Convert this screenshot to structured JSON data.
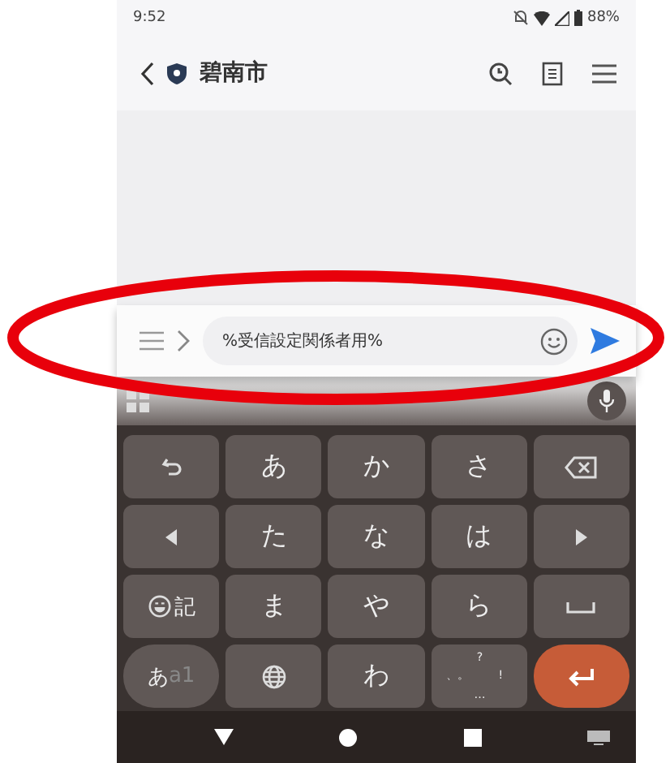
{
  "status_bar": {
    "time": "9:52",
    "battery": "88%"
  },
  "header": {
    "title": "碧南市"
  },
  "input_bar": {
    "value": "%受信設定関係者用%"
  },
  "keyboard": {
    "rows": [
      [
        {
          "kind": "undo"
        },
        {
          "kind": "char",
          "label": "あ"
        },
        {
          "kind": "char",
          "label": "か"
        },
        {
          "kind": "char",
          "label": "さ"
        },
        {
          "kind": "backspace"
        }
      ],
      [
        {
          "kind": "left"
        },
        {
          "kind": "char",
          "label": "た"
        },
        {
          "kind": "char",
          "label": "な"
        },
        {
          "kind": "char",
          "label": "は"
        },
        {
          "kind": "right"
        }
      ],
      [
        {
          "kind": "emoji",
          "label": "記"
        },
        {
          "kind": "char",
          "label": "ま"
        },
        {
          "kind": "char",
          "label": "や"
        },
        {
          "kind": "char",
          "label": "ら"
        },
        {
          "kind": "space"
        }
      ],
      [
        {
          "kind": "mode",
          "label": "あ",
          "secondary": "a1"
        },
        {
          "kind": "globe"
        },
        {
          "kind": "char",
          "label": "わ"
        },
        {
          "kind": "punct",
          "labels": [
            "?",
            "、。",
            "!",
            "…"
          ]
        },
        {
          "kind": "enter"
        }
      ]
    ]
  }
}
